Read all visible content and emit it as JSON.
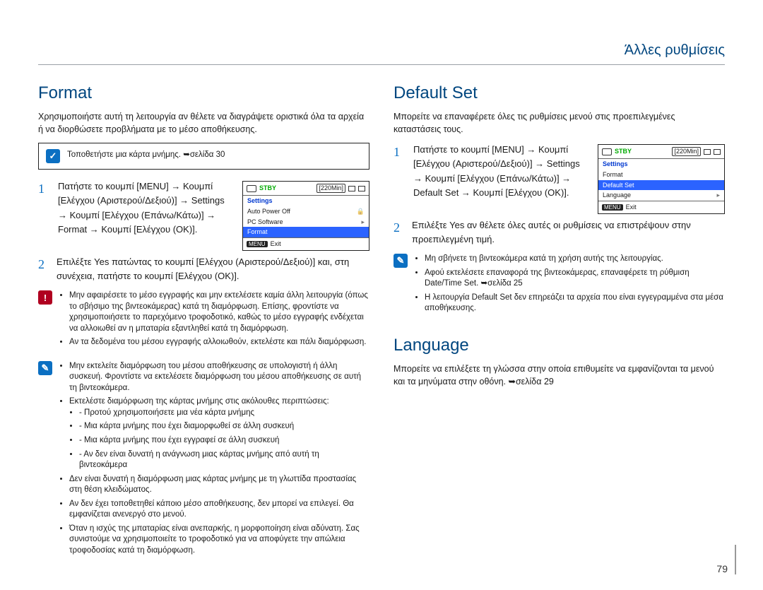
{
  "running_head": "Άλλες ρυθμίσεις",
  "page_number": "79",
  "format": {
    "title": "Format",
    "intro": "Χρησιμοποιήστε αυτή τη λειτουργία αν θέλετε να διαγράψετε οριστικά όλα τα αρχεία ή να διορθώσετε προβλήματα με το μέσο αποθήκευσης.",
    "insert_card_note": "Τοποθετήστε μια κάρτα μνήμης. ➥σελίδα 30",
    "step1": "Πατήστε το κουμπί [MENU] → Κουμπί [Ελέγχου (Αριστερού/Δεξιού)] → Settings → Κουμπί [Ελέγχου (Επάνω/Κάτω)] → Format → Κουμπί [Ελέγχου (OK)].",
    "step2": "Επιλέξτε Yes πατώντας το κουμπί [Ελέγχου (Αριστερού/Δεξιού)] και, στη συνέχεια, πατήστε το κουμπί [Ελέγχου (OK)].",
    "lcd": {
      "stby": "STBY",
      "time": "[220Min]",
      "header": "Settings",
      "rows": [
        "Auto Power Off",
        "PC Software",
        "Format"
      ],
      "selected_index": 2,
      "exit": "Exit",
      "menu_btn": "MENU"
    },
    "warn": [
      "Μην αφαιρέσετε το μέσο εγγραφής και μην εκτελέσετε καμία άλλη λειτουργία (όπως το σβήσιμο της βιντεοκάμερας) κατά τη διαμόρφωση. Επίσης, φροντίστε να χρησιμοποιήσετε το παρεχόμενο τροφοδοτικό, καθώς το μέσο εγγραφής ενδέχεται να αλλοιωθεί αν η μπαταρία εξαντληθεί κατά τη διαμόρφωση.",
      "Αν τα δεδομένα του μέσου εγγραφής αλλοιωθούν, εκτελέστε και πάλι διαμόρφωση."
    ],
    "info": {
      "lead": "Μην εκτελείτε διαμόρφωση του μέσου αποθήκευσης σε υπολογιστή ή άλλη συσκευή. Φροντίστε να εκτελέσετε διαμόρφωση του μέσου αποθήκευσης σε αυτή τη βιντεοκάμερα.",
      "bullet2": "Εκτελέστε διαμόρφωση της κάρτας μνήμης στις ακόλουθες περιπτώσεις:",
      "sub": [
        "Προτού χρησιμοποιήσετε μια νέα κάρτα μνήμης",
        "Μια κάρτα μνήμης που έχει διαμορφωθεί σε άλλη συσκευή",
        "Μια κάρτα μνήμης που έχει εγγραφεί σε άλλη συσκευή",
        "Αν δεν είναι δυνατή η ανάγνωση μιας κάρτας μνήμης από αυτή τη βιντεοκάμερα"
      ],
      "bullet3": "Δεν είναι δυνατή η διαμόρφωση μιας κάρτας μνήμης με τη γλωττίδα προστασίας στη θέση κλειδώματος.",
      "bullet4": "Αν δεν έχει τοποθετηθεί κάποιο μέσο αποθήκευσης, δεν μπορεί να επιλεγεί. Θα εμφανίζεται ανενεργό στο μενού.",
      "bullet5": "Όταν η ισχύς της μπαταρίας είναι ανεπαρκής, η μορφοποίηση είναι αδύνατη. Σας συνιστούμε να χρησιμοποιείτε το τροφοδοτικό για να αποφύγετε την απώλεια τροφοδοσίας κατά τη διαμόρφωση."
    }
  },
  "defaultset": {
    "title": "Default Set",
    "intro": "Μπορείτε να επαναφέρετε όλες τις ρυθμίσεις μενού στις προεπιλεγμένες καταστάσεις τους.",
    "step1": "Πατήστε το κουμπί [MENU] → Κουμπί [Ελέγχου (Αριστερού/Δεξιού)] → Settings → Κουμπί [Ελέγχου (Επάνω/Κάτω)] → Default Set → Κουμπί [Ελέγχου (OK)].",
    "step2": "Επιλέξτε Yes αν θέλετε όλες αυτές οι ρυθμίσεις να επιστρέψουν στην προεπιλεγμένη τιμή.",
    "lcd": {
      "stby": "STBY",
      "time": "[220Min]",
      "header": "Settings",
      "rows": [
        "Format",
        "Default Set",
        "Language"
      ],
      "selected_index": 1,
      "exit": "Exit",
      "menu_btn": "MENU"
    },
    "info": [
      "Μη σβήνετε τη βιντεοκάμερα κατά τη χρήση αυτής της λειτουργίας.",
      "Αφού εκτελέσετε επαναφορά της βιντεοκάμερας, επαναφέρετε τη ρύθμιση Date/Time Set. ➥σελίδα 25",
      "Η λειτουργία Default Set δεν επηρεάζει τα αρχεία που είναι εγγεγραμμένα στα μέσα αποθήκευσης."
    ]
  },
  "language": {
    "title": "Language",
    "intro": "Μπορείτε να επιλέξετε τη γλώσσα στην οποία επιθυμείτε να εμφανίζονται τα μενού και τα μηνύματα στην οθόνη. ➥σελίδα 29"
  }
}
